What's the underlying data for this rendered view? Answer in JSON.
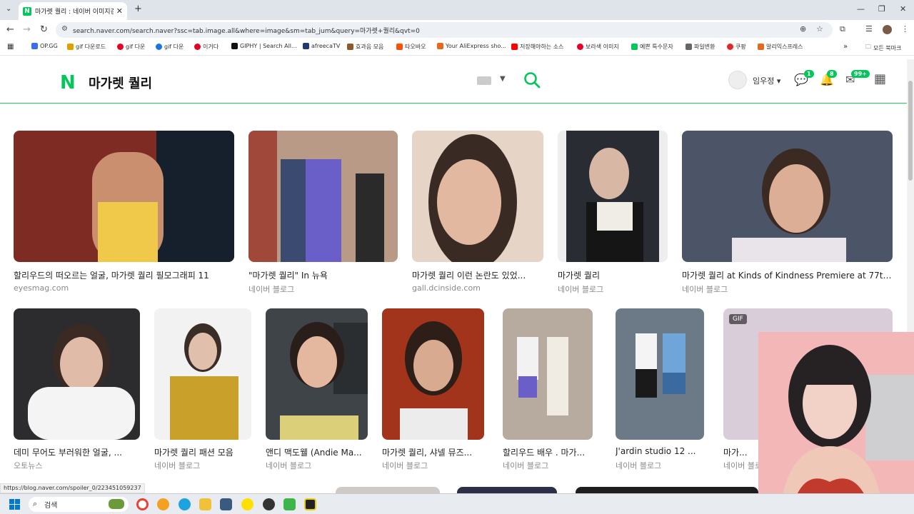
{
  "browser": {
    "tab_title": "마가렛 퀄리 : 네이버 이미지검색",
    "tab_favicon": "N",
    "url": "search.naver.com/search.naver?ssc=tab.image.all&where=image&sm=tab_jum&query=마가렛+퀄리&qvt=0",
    "status_url": "https://blog.naver.com/spoiler_0/223451059237"
  },
  "bookmarks": [
    {
      "label": "OP.GG",
      "color": "#3c6df0"
    },
    {
      "label": "gif 다운로드",
      "color": "#e0a000"
    },
    {
      "label": "gif 다운",
      "color": "#e60023"
    },
    {
      "label": "gif 다운",
      "color": "#1a73e8"
    },
    {
      "label": "이거다",
      "color": "#e60023"
    },
    {
      "label": "GIPHY | Search All...",
      "color": "#111111"
    },
    {
      "label": "afreecaTV",
      "color": "#1f3a6e"
    },
    {
      "label": "효과음 모음",
      "color": "#8a5a2b"
    },
    {
      "label": "타오바오",
      "color": "#ff5000"
    },
    {
      "label": "Your AliExpress sho...",
      "color": "#e66a1e"
    },
    {
      "label": "저장해야하는 소스",
      "color": "#ff0000"
    },
    {
      "label": "보라색 이미지",
      "color": "#e60023"
    },
    {
      "label": "예쁜 특수문자",
      "color": "#03c75a"
    },
    {
      "label": "파일변환",
      "color": "#666666"
    },
    {
      "label": "쿠팡",
      "color": "#e52528"
    },
    {
      "label": "알리익스프레스",
      "color": "#e66a1e"
    }
  ],
  "all_bookmarks": "모든 북마크",
  "header": {
    "logo": "N",
    "query": "마가렛 퀄리",
    "username": "임우정",
    "badges": {
      "talk": "1",
      "alarm": "8",
      "mail": "99+"
    }
  },
  "accent": "#03c75a",
  "results_row1": [
    {
      "caption": "할리우드의 떠오르는 얼굴, 마가렛 퀄리 필모그래피 11",
      "source": "eyesmag.com"
    },
    {
      "caption": "\"마가렛 퀄리\" In 뉴욕",
      "source": "네이버 블로그"
    },
    {
      "caption": "마가렛 퀄리 이런 논란도 있었...",
      "source": "gall.dcinside.com"
    },
    {
      "caption": "마가렛 퀄리",
      "source": "네이버 블로그"
    },
    {
      "caption": "마가렛 퀄리 at Kinds of Kindness Premiere at 77th...",
      "source": "네이버 블로그"
    }
  ],
  "results_row2": [
    {
      "caption": "데미 무어도 부러워한 얼굴, ...",
      "source": "오토뉴스"
    },
    {
      "caption": "마가렛 퀄리 패션 모음",
      "source": "네이버 블로그"
    },
    {
      "caption": "앤디 맥도웰 (Andie Ma...",
      "source": "네이버 블로그"
    },
    {
      "caption": "마가렛 퀄리, 샤넬 뮤즈...",
      "source": "네이버 블로그"
    },
    {
      "caption": "할리우드 배우 . 마가...",
      "source": "네이버 블로그"
    },
    {
      "caption": "J'ardin studio 12 ...",
      "source": "네이버 블로그"
    },
    {
      "caption": "마가...",
      "source": "네이버 블로그",
      "badge": "GIF"
    }
  ],
  "taskbar": {
    "search_label": "검색"
  }
}
